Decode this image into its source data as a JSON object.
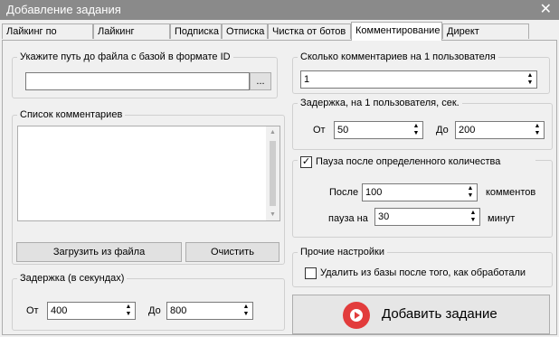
{
  "window": {
    "title": "Добавление задания",
    "close_glyph": "✕"
  },
  "tabs": [
    {
      "label": "Лайкинг по списку",
      "active": false
    },
    {
      "label": "Лайкинг ленты",
      "active": false
    },
    {
      "label": "Подписка",
      "active": false
    },
    {
      "label": "Отписка",
      "active": false
    },
    {
      "label": "Чистка от ботов",
      "active": false
    },
    {
      "label": "Комментирование",
      "active": true
    },
    {
      "label": "Директ рассылка",
      "active": false
    }
  ],
  "file_group": {
    "legend": "Укажите путь до файла с базой в формате ID",
    "path_value": "",
    "browse_label": "..."
  },
  "comments_group": {
    "legend": "Список комментариев",
    "content": "",
    "load_label": "Загрузить из файла",
    "clear_label": "Очистить"
  },
  "delay_sec_group": {
    "legend": "Задержка (в секундах)",
    "from_label": "От",
    "from_value": "400",
    "to_label": "До",
    "to_value": "800"
  },
  "comments_per_user_group": {
    "legend": "Сколько комментариев на 1 пользователя",
    "value": "1"
  },
  "delay_per_user_group": {
    "legend": "Задержка, на 1 пользователя, сек.",
    "from_label": "От",
    "from_value": "50",
    "to_label": "До",
    "to_value": "200"
  },
  "pause_group": {
    "legend": "Пауза после определенного количества",
    "checked": true,
    "after_label": "После",
    "after_value": "100",
    "after_unit": "комментов",
    "pause_label": "пауза на",
    "pause_value": "30",
    "pause_unit": "минут"
  },
  "other_group": {
    "legend": "Прочие настройки",
    "remove_label": "Удалить из базы после того, как обработали",
    "remove_checked": false
  },
  "add_task_button": {
    "label": "Добавить задание"
  },
  "colors": {
    "accent": "#e23c3c",
    "titlebar": "#8a8a8a"
  }
}
